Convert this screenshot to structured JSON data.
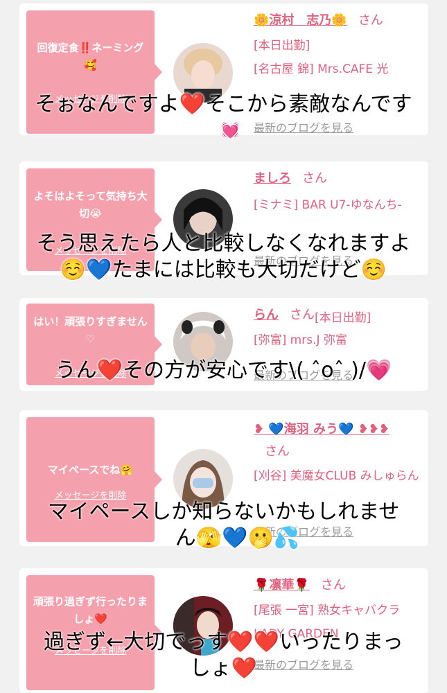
{
  "cards": [
    {
      "message": "回復定食‼️ネーミング🥰",
      "delete_label": "メッセージを削除",
      "name": "🌼涼村　志乃🌼",
      "san": "さん",
      "info_lines": [
        "[本日出勤]",
        "[名古屋 錦] Mrs.CAFE 光"
      ],
      "blog_label": "最新のブログを見る"
    },
    {
      "message": "よそはよそって気持ち大切😭",
      "delete_label": "メッセージを削除",
      "name": "ましろ",
      "san": "さん",
      "info_lines": [
        "[ミナミ] BAR U7-ゆなんち-"
      ],
      "blog_label": "最新のブログを見る"
    },
    {
      "message": "はい！頑張りすぎません♡",
      "delete_label": "メッセージを削除",
      "name": "らん",
      "san": "さん",
      "info_lines": [
        "[本日出勤]",
        "[弥富] mrs.J 弥富"
      ],
      "blog_label": "最新のブログを見る"
    },
    {
      "message": "マイペースでね🤗",
      "delete_label": "メッセージを削除",
      "name": "❥ 💙海羽 みう💙 ❥❥❥",
      "san": "さん",
      "info_lines": [
        "[刈谷] 美魔女CLUB みしゅらん"
      ],
      "blog_label": "最新のブログを見る"
    },
    {
      "message": "頑張り過ぎず行ったりましょ❤️",
      "delete_label": "メッセージを削除",
      "name": "🌹凛華🌹",
      "san": "さん",
      "info_lines": [
        "[尾張 一宮] 熟女キャバクラ LADY GARDEN"
      ],
      "blog_label": "最新のブログを見る"
    }
  ],
  "overlays": [
    [
      "そぉなんですよ❤️そこから素敵なんです",
      "💓"
    ],
    [
      "そう思えたら人と比較しなくなれますよ",
      "☺️💙たまには比較も大切だけど☺️"
    ],
    [
      "うん❤️その方が安心です\\( ˆoˆ )/💗"
    ],
    [
      "マイペースしか知らないかもしれませ",
      "ん🫣💙🫢💦"
    ],
    [
      "過ぎず←大切でっす❤️❤️いったりまっ",
      "しょ❤️"
    ]
  ]
}
